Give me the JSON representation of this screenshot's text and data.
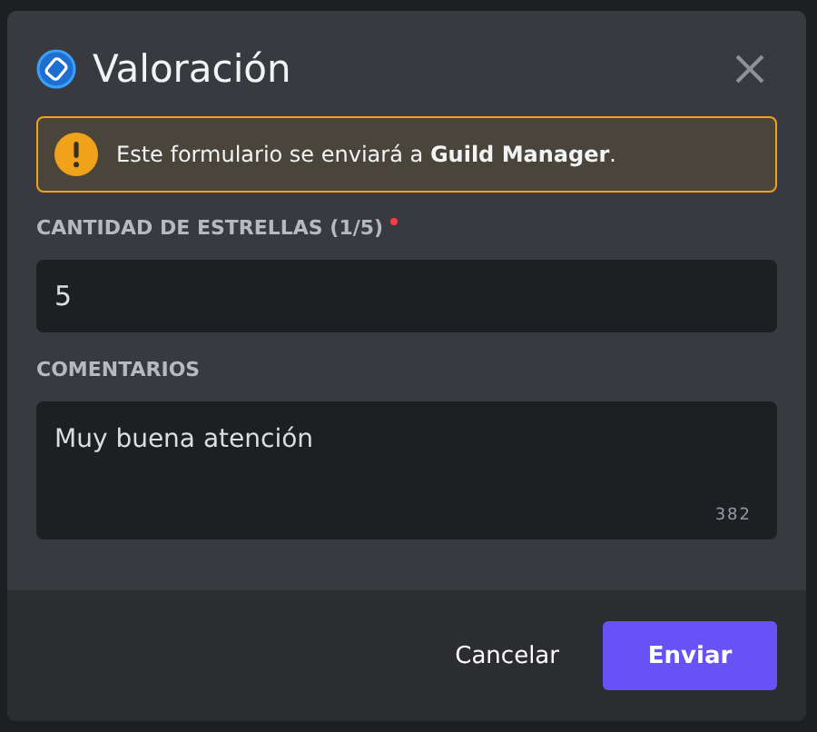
{
  "modal": {
    "title": "Valoración"
  },
  "notice": {
    "text": "Este formulario se enviará a **Guild Manager**."
  },
  "fields": [
    {
      "kind": "input",
      "label": "CANTIDAD DE ESTRELLAS (1/5)",
      "required": true,
      "value": "5"
    },
    {
      "kind": "textarea",
      "label": "COMENTARIOS",
      "required": false,
      "value": "Muy buena atención",
      "counter": "382"
    }
  ],
  "buttons": [
    {
      "label": "Cancelar",
      "kind": "link"
    },
    {
      "label": "Enviar",
      "kind": "primary"
    }
  ]
}
